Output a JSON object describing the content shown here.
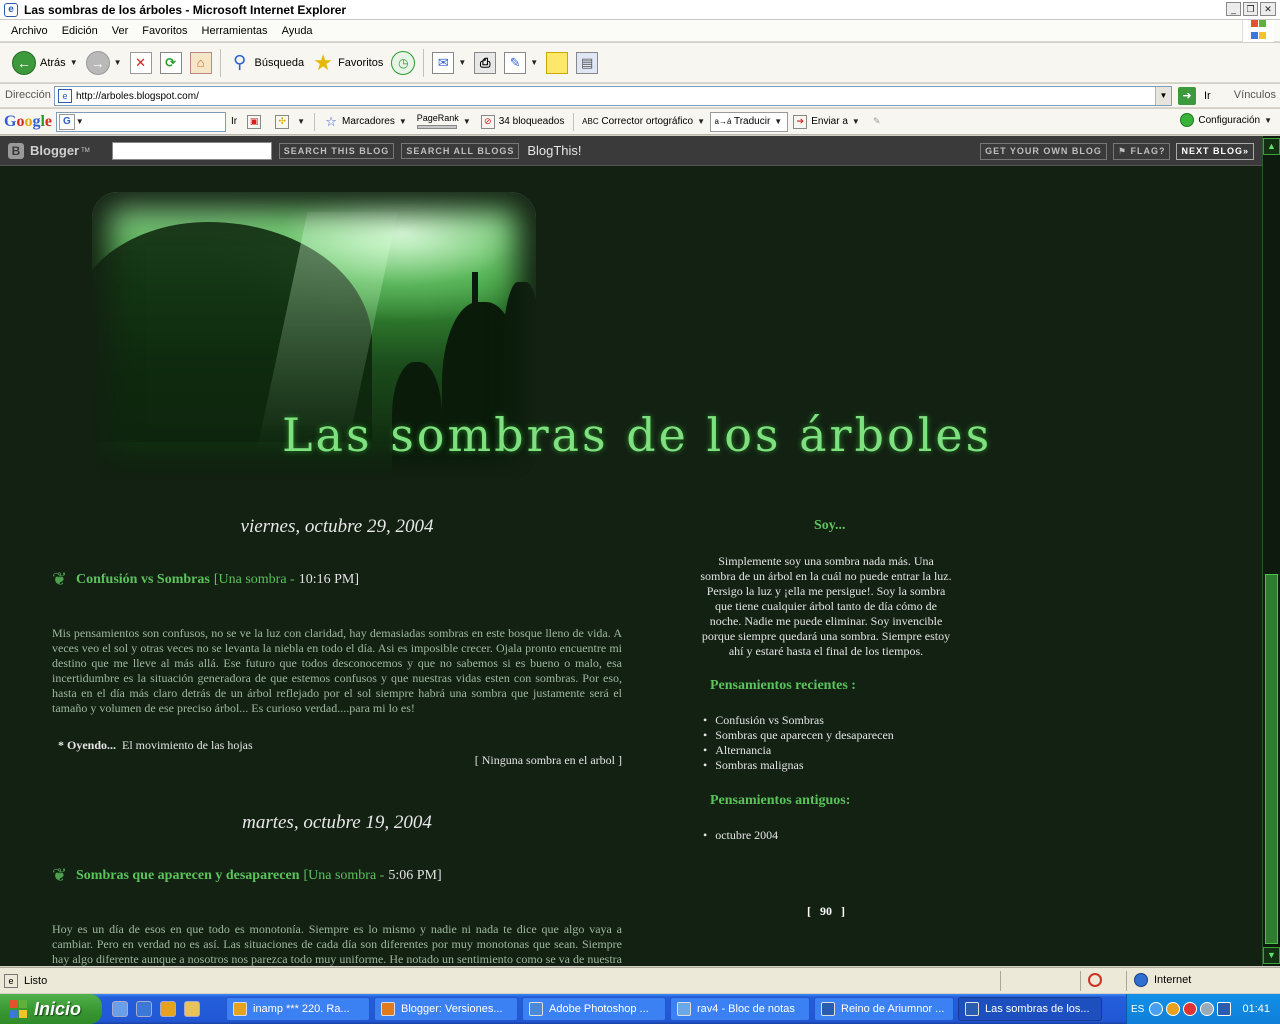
{
  "window": {
    "title": "Las sombras de los árboles - Microsoft Internet Explorer"
  },
  "menu": [
    "Archivo",
    "Edición",
    "Ver",
    "Favoritos",
    "Herramientas",
    "Ayuda"
  ],
  "toolbar": {
    "back_label": "Atrás",
    "search_label": "Búsqueda",
    "favorites_label": "Favoritos"
  },
  "address": {
    "label": "Dirección",
    "url": "http://arboles.blogspot.com/",
    "go_label": "Ir",
    "links_label": "Vínculos"
  },
  "google_bar": {
    "logo": [
      "G",
      "o",
      "o",
      "g",
      "l",
      "e"
    ],
    "go_label": "Ir",
    "bookmarks": "Marcadores",
    "pagerank": "PageRank",
    "blocked": "34 bloqueados",
    "spellcheck": "Corrector ortográfico",
    "translate": "Traducir",
    "send_to": "Enviar a",
    "settings": "Configuración"
  },
  "blogger_bar": {
    "logo": "Blogger",
    "search_this": "SEARCH THIS BLOG",
    "search_all": "SEARCH ALL BLOGS",
    "blogthis": "BlogThis!",
    "get_own": "GET YOUR OWN BLOG",
    "flag": "FLAG?",
    "next": "NEXT BLOG»"
  },
  "blog": {
    "title": "Las sombras de los árboles",
    "posts": [
      {
        "date": "viernes, octubre 29, 2004",
        "title": "Confusión vs Sombras",
        "author_prefix": "[Una sombra - ",
        "time": "10:16 PM",
        "close": "]",
        "body": "Mis pensamientos son confusos, no se ve la luz con claridad, hay demasiadas sombras en este bosque lleno de vida. A veces veo el sol y otras veces no se levanta la niebla en todo el día. Asi es imposible crecer. Ojala pronto encuentre mi destino que me lleve al más allá. Ese futuro que todos desconocemos y que no sabemos si es bueno o malo, esa incertidumbre es la situación generadora de que estemos confusos y que nuestras vidas esten con sombras. Por eso, hasta en el día más claro detrás de un árbol reflejado por el sol siempre habrá una sombra que justamente será el tamaño y volumen de ese preciso árbol... Es curioso verdad....para mi lo es!",
        "listening_label": "* Oyendo...",
        "listening_value": "El movimiento de las hojas",
        "comments": "[ Ninguna sombra en el arbol ]"
      },
      {
        "date": "martes, octubre 19, 2004",
        "title": "Sombras que aparecen y desaparecen",
        "author_prefix": "[Una sombra - ",
        "time": "5:06 PM",
        "close": "]",
        "body": "Hoy es un día de esos en que todo es monotonía. Siempre es lo mismo y nadie ni nada te dice que algo vaya a cambiar. Pero en verdad no es así. Las situaciones de cada día son diferentes por muy monotonas que sean. Siempre hay algo diferente aunque a nosotros nos parezca todo muy uniforme. He notado un sentimiento como se va de nuestra vida"
      }
    ],
    "sidebar": {
      "about_heading": "Soy...",
      "about_text": "Simplemente soy una sombra nada más. Una sombra de un árbol en la cuál no puede entrar la luz. Persigo la luz y ¡ella me persigue!. Soy la sombra que tiene cualquier árbol tanto de día cómo de noche. Nadie me puede eliminar. Soy invencible porque siempre quedará una sombra. Siempre estoy ahí y estaré hasta el final de los tiempos.",
      "recent_heading": "Pensamientos recientes :",
      "recent": [
        "Confusión vs Sombras",
        "Sombras que aparecen y desaparecen",
        "Alternancia",
        "Sombras malignas"
      ],
      "archive_heading": "Pensamientos antiguos:",
      "archive": [
        "octubre 2004"
      ],
      "counter": "[ 90 ]"
    }
  },
  "status": {
    "text": "Listo",
    "zone": "Internet"
  },
  "taskbar": {
    "start": "Inicio",
    "tasks": [
      {
        "label": "inamp *** 220. Ra...",
        "color": "#e6a21f"
      },
      {
        "label": "Blogger: Versiones...",
        "color": "#e07a1f"
      },
      {
        "label": "Adobe Photoshop ...",
        "color": "#4a8ad8"
      },
      {
        "label": "rav4 - Bloc de notas",
        "color": "#6aa8e8"
      },
      {
        "label": "Reino de Ariumnor ...",
        "color": "#2a5db0"
      },
      {
        "label": "Las sombras de los...",
        "color": "#2a5db0"
      }
    ],
    "lang": "ES",
    "clock": "01:41"
  }
}
